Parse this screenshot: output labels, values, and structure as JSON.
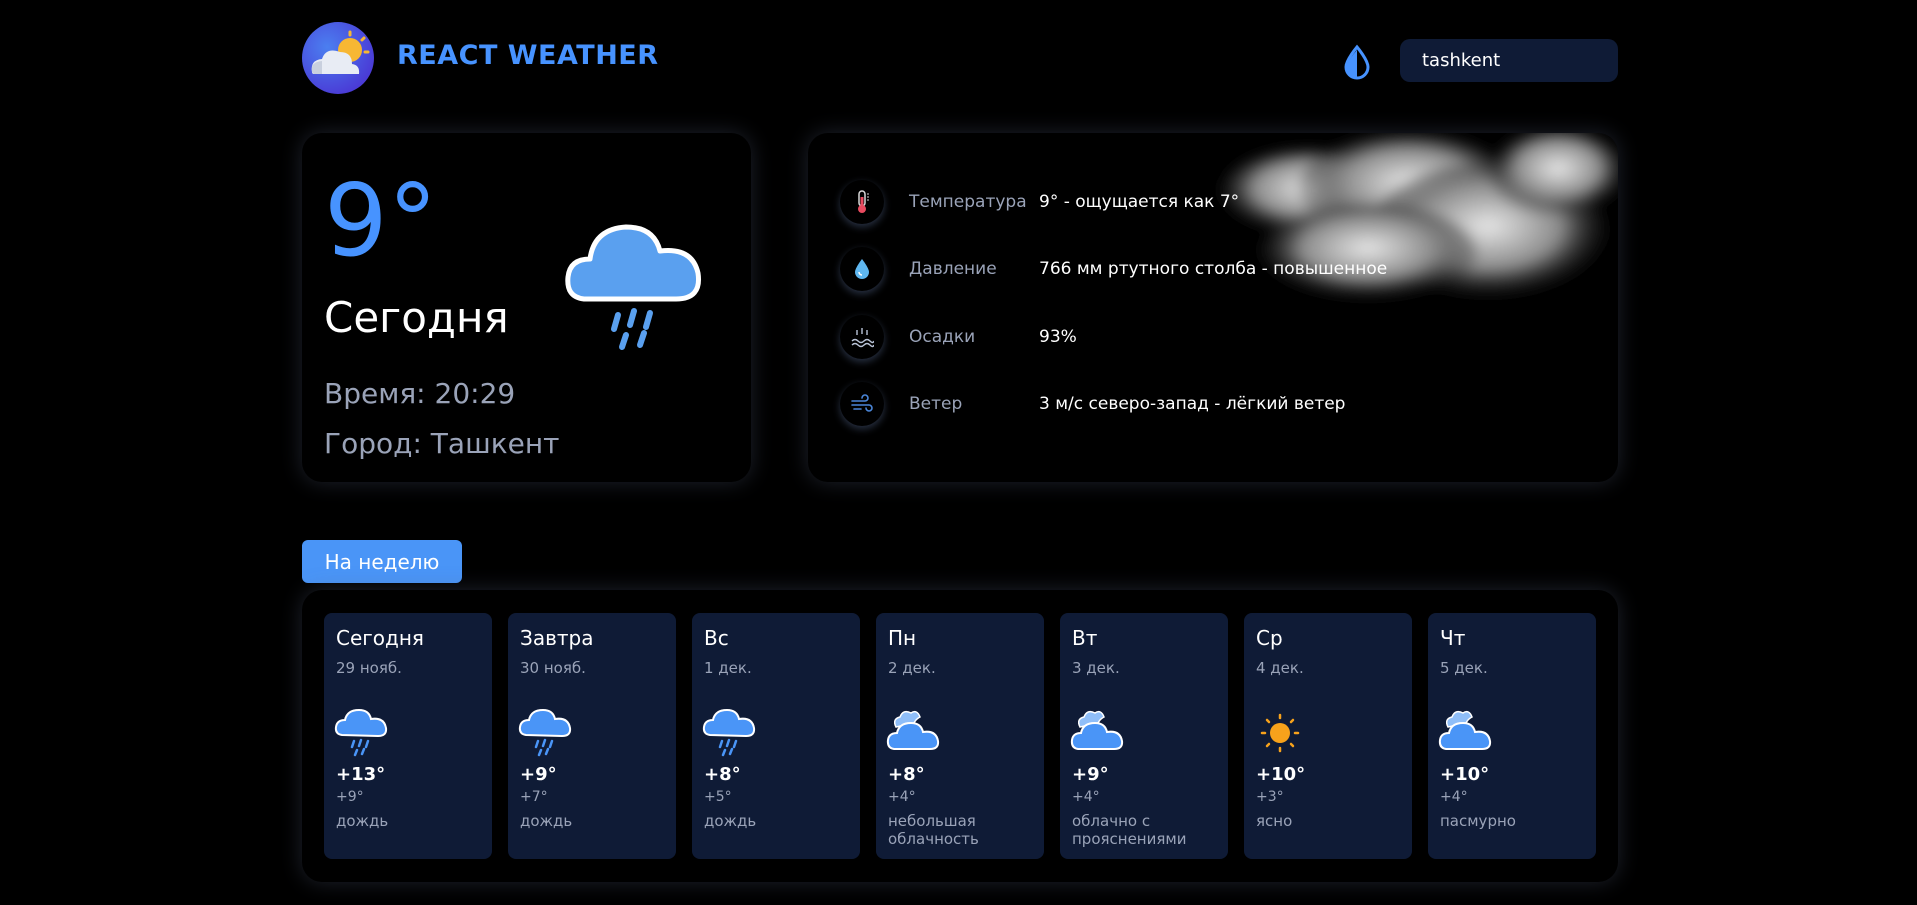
{
  "header": {
    "brand": "REACT WEATHER",
    "search_value": "tashkent"
  },
  "today": {
    "temp": "9°",
    "label": "Сегодня",
    "time": "Время: 20:29",
    "city": "Город: Ташкент"
  },
  "details": [
    {
      "name": "Температура",
      "value": "9° - ощущается как 7°"
    },
    {
      "name": "Давление",
      "value": "766 мм ртутного столба - повышенное"
    },
    {
      "name": "Осадки",
      "value": "93%"
    },
    {
      "name": "Ветер",
      "value": "3 м/с северо-запад - лёгкий ветер"
    }
  ],
  "week": {
    "tab_label": "На неделю",
    "days": [
      {
        "name": "Сегодня",
        "date": "29 нояб.",
        "max": "+13°",
        "min": "+9°",
        "desc": "дождь",
        "icon": "rain-icon"
      },
      {
        "name": "Завтра",
        "date": "30 нояб.",
        "max": "+9°",
        "min": "+7°",
        "desc": "дождь",
        "icon": "rain-icon"
      },
      {
        "name": "Вс",
        "date": "1 дек.",
        "max": "+8°",
        "min": "+5°",
        "desc": "дождь",
        "icon": "rain-icon"
      },
      {
        "name": "Пн",
        "date": "2 дек.",
        "max": "+8°",
        "min": "+4°",
        "desc": "небольшая облачность",
        "icon": "cloudy-icon"
      },
      {
        "name": "Вт",
        "date": "3 дек.",
        "max": "+9°",
        "min": "+4°",
        "desc": "облачно с прояснениями",
        "icon": "cloudy-icon"
      },
      {
        "name": "Ср",
        "date": "4 дек.",
        "max": "+10°",
        "min": "+3°",
        "desc": "ясно",
        "icon": "sun-icon"
      },
      {
        "name": "Чт",
        "date": "5 дек.",
        "max": "+10°",
        "min": "+4°",
        "desc": "пасмурно",
        "icon": "cloudy-icon"
      }
    ]
  },
  "colors": {
    "accent": "#4793ff",
    "card_bg": "#0f1b36",
    "muted": "#9aa3b8"
  }
}
